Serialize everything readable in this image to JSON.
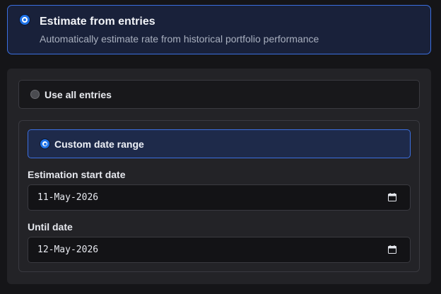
{
  "estimate": {
    "title": "Estimate from entries",
    "subtitle": "Automatically estimate rate from historical portfolio performance"
  },
  "options": {
    "all_entries": {
      "label": "Use all entries"
    },
    "custom_range": {
      "label": "Custom date range"
    }
  },
  "fields": {
    "start_date": {
      "label": "Estimation start date",
      "value": "11-May-2026"
    },
    "until_date": {
      "label": "Until date",
      "value": "12-May-2026"
    }
  },
  "icons": {
    "radio_selected": "radio-selected-icon",
    "radio_unselected": "radio-unselected-icon",
    "calendar": "calendar-icon"
  },
  "colors": {
    "accent": "#1f73e8",
    "selected_border": "#3b6fe0",
    "background": "#151518",
    "panel": "#232327"
  }
}
